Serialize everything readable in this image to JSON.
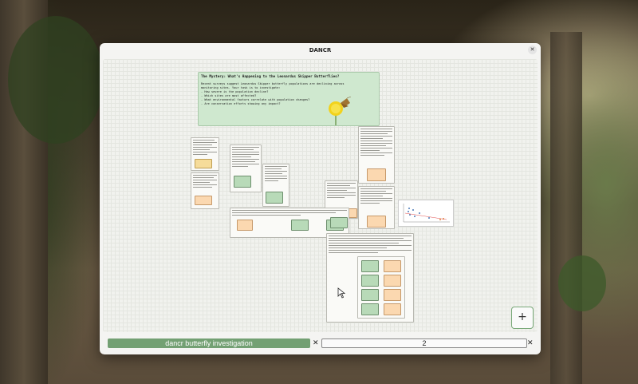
{
  "window": {
    "title": "DANCR",
    "close_label": "✕"
  },
  "mystery": {
    "title_prefix": "The Mystery: ",
    "title": "What's Happening to the Leonardus Skipper Butterflies?",
    "lines": [
      "Recent surveys suggest Leonardus Skipper butterfly populations are declining across",
      "monitoring sites. Your task is to investigate:",
      "- How severe is the population decline?",
      "- Which sites are most affected?",
      "- What environmental factors correlate with population changes?",
      "- Are conservation efforts showing any impact?"
    ]
  },
  "add_button": {
    "label": "+"
  },
  "tabs": [
    {
      "label": "dancr butterfly investigation",
      "close": "✕",
      "active": true
    },
    {
      "label": "2",
      "close": "✕",
      "active": false
    }
  ],
  "colors": {
    "accent_green": "#73a073",
    "note_green": "#cfe8cf",
    "card_orange": "#fbd8b0"
  }
}
